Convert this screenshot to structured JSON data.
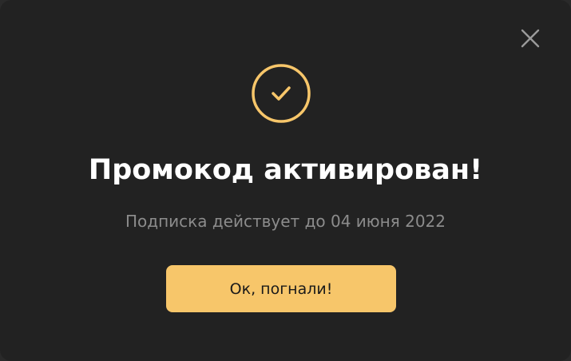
{
  "modal": {
    "close_icon": "close-icon",
    "status_icon": "check-circle-icon",
    "title": "Промокод активирован!",
    "subtitle": "Подписка действует до 04 июня 2022",
    "confirm_label": "Ок, погнали!"
  },
  "colors": {
    "background": "#222222",
    "accent": "#f7c66a",
    "title_text": "#ffffff",
    "subtitle_text": "#8c8c8c",
    "close_icon": "#9a9a9a",
    "button_text": "#1a1a1a"
  }
}
